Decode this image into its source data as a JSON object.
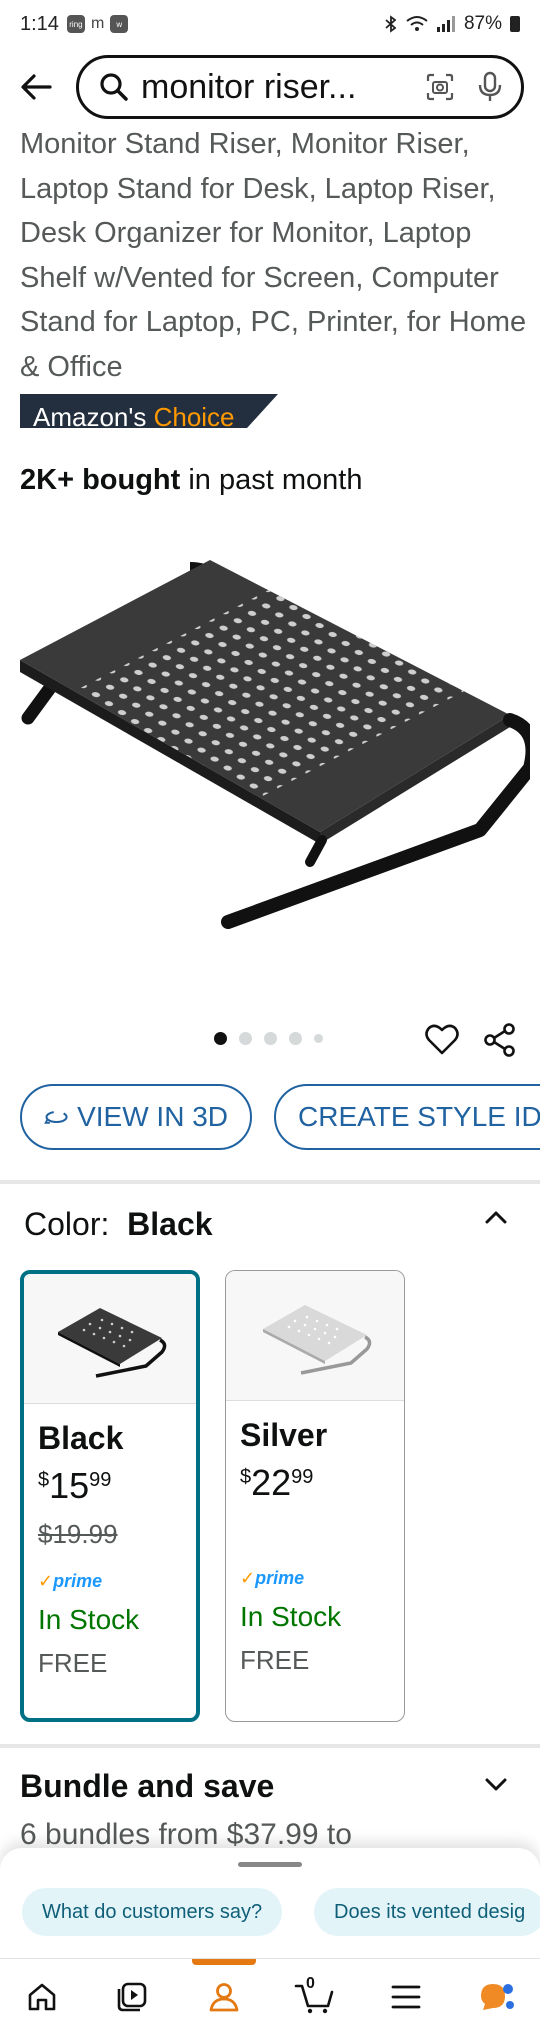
{
  "status_bar": {
    "time": "1:14",
    "notification_icons": [
      "ring",
      "m",
      "wear"
    ],
    "battery": "87%"
  },
  "search": {
    "query": "monitor riser..."
  },
  "product": {
    "title": "Monitor Stand Riser, Monitor Riser, Laptop Stand for Desk, Laptop Riser, Desk Organizer for Monitor, Laptop Shelf w/Vented for Screen, Computer Stand for Laptop, PC, Printer, for Home & Office",
    "badge": {
      "part1": "Amazon's",
      "part2": "Choice"
    },
    "bought": {
      "bold": "2K+ bought",
      "rest": " in past month"
    }
  },
  "carousel": {
    "total_dots": 5,
    "active_index": 0
  },
  "actions": {
    "view_3d": "VIEW IN 3D",
    "create_style": "CREATE STYLE IDE"
  },
  "color": {
    "label": "Color:",
    "selected": "Black",
    "options": [
      {
        "name": "Black",
        "price_symbol": "$",
        "price_whole": "15",
        "price_cents": "99",
        "list_price": "$19.99",
        "prime": "prime",
        "stock": "In Stock",
        "shipping": "FREE"
      },
      {
        "name": "Silver",
        "price_symbol": "$",
        "price_whole": "22",
        "price_cents": "99",
        "list_price": "",
        "prime": "prime",
        "stock": "In Stock",
        "shipping": "FREE"
      }
    ]
  },
  "bundle": {
    "title": "Bundle and save",
    "subtitle": "6 bundles from $37.99 to"
  },
  "chips": [
    "What do customers say?",
    "Does its vented desig"
  ],
  "nav": {
    "cart_count": "0",
    "active": "account"
  },
  "colors": {
    "accent_blue": "#2162a1",
    "teal_selected": "#007185",
    "in_stock_green": "#007600",
    "nav_active_orange": "#e47911"
  }
}
